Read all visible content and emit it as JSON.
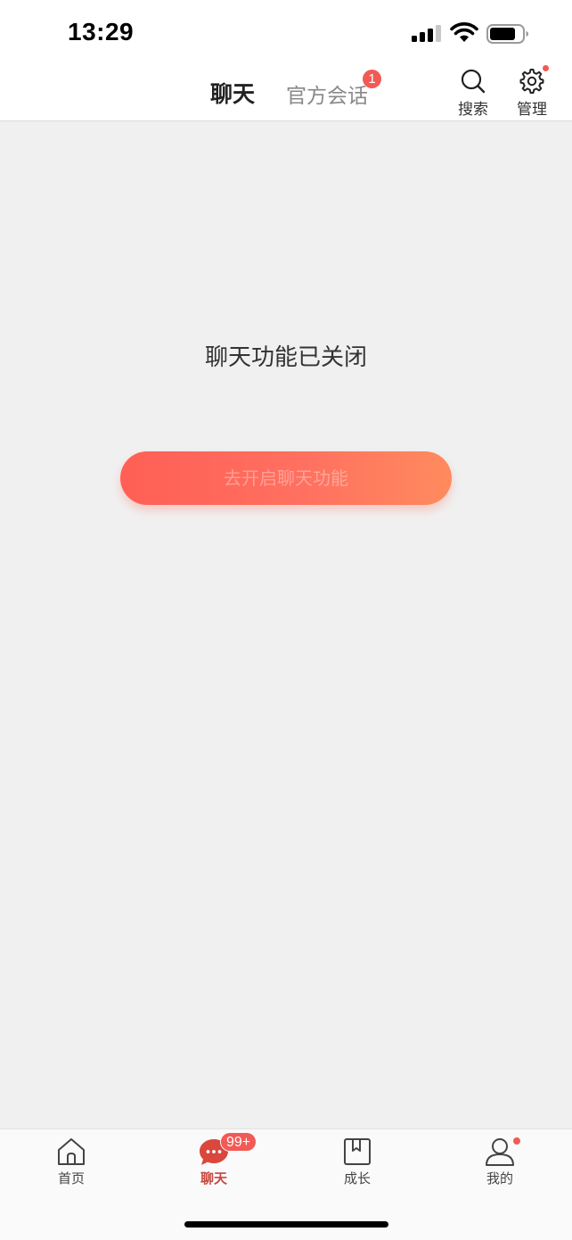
{
  "status_bar": {
    "time": "13:29"
  },
  "header": {
    "tabs": [
      {
        "label": "聊天",
        "active": true
      },
      {
        "label": "官方会话",
        "active": false,
        "badge": "1"
      }
    ],
    "actions": {
      "search_label": "搜索",
      "search_icon": "search-icon",
      "manage_label": "管理",
      "manage_icon": "gear-icon"
    }
  },
  "main": {
    "message": "聊天功能已关闭",
    "button_label": "去开启聊天功能"
  },
  "tab_bar": {
    "items": [
      {
        "label": "首页",
        "icon": "home-icon"
      },
      {
        "label": "聊天",
        "icon": "chat-bubble-icon",
        "badge": "99+",
        "active": true
      },
      {
        "label": "成长",
        "icon": "bookmark-icon"
      },
      {
        "label": "我的",
        "icon": "user-icon"
      }
    ]
  },
  "colors": {
    "accent": "#f25a55",
    "active_tab": "#c8463e",
    "button_gradient_start": "#ff5f55",
    "button_gradient_end": "#ff8b5d",
    "background": "#f0f0f0"
  }
}
